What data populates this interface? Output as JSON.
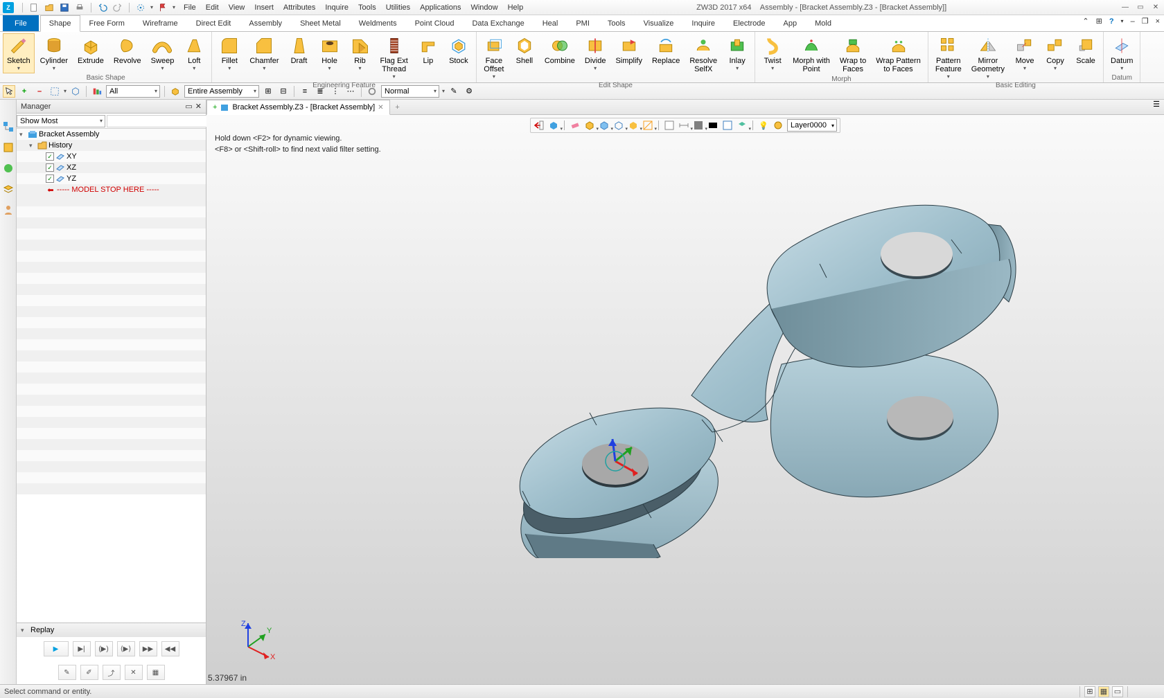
{
  "titlebar": {
    "app_title": "ZW3D 2017  x64",
    "doc_title": "Assembly - [Bracket Assembly.Z3 - [Bracket Assembly]]"
  },
  "menus": [
    "File",
    "Edit",
    "View",
    "Insert",
    "Attributes",
    "Inquire",
    "Tools",
    "Utilities",
    "Applications",
    "Window",
    "Help"
  ],
  "ribbon_tabs": [
    "File",
    "Shape",
    "Free Form",
    "Wireframe",
    "Direct Edit",
    "Assembly",
    "Sheet Metal",
    "Weldments",
    "Point Cloud",
    "Data Exchange",
    "Heal",
    "PMI",
    "Tools",
    "Visualize",
    "Inquire",
    "Electrode",
    "App",
    "Mold"
  ],
  "active_tab": "Shape",
  "ribbon_groups": {
    "basic_shape": {
      "label": "Basic Shape",
      "items": [
        "Sketch",
        "Cylinder",
        "Extrude",
        "Revolve",
        "Sweep",
        "Loft"
      ]
    },
    "eng_feature": {
      "label": "Engineering Feature",
      "items": [
        "Fillet",
        "Chamfer",
        "Draft",
        "Hole",
        "Rib",
        "Flag Ext\nThread",
        "Lip",
        "Stock"
      ]
    },
    "edit_shape": {
      "label": "Edit Shape",
      "items": [
        "Face\nOffset",
        "Shell",
        "Combine",
        "Divide",
        "Simplify",
        "Replace",
        "Resolve\nSelfX",
        "Inlay"
      ]
    },
    "morph": {
      "label": "Morph",
      "items": [
        "Twist",
        "Morph with\nPoint",
        "Wrap to\nFaces",
        "Wrap Pattern\nto Faces"
      ]
    },
    "basic_editing": {
      "label": "Basic Editing",
      "items": [
        "Pattern\nFeature",
        "Mirror\nGeometry",
        "Move",
        "Copy",
        "Scale"
      ]
    },
    "datum": {
      "label": "Datum",
      "items": [
        "Datum"
      ]
    }
  },
  "filter_bar": {
    "filter_label": "All",
    "scope_label": "Entire Assembly",
    "display_label": "Normal"
  },
  "manager": {
    "title": "Manager",
    "show_combo": "Show Most",
    "root": "Bracket Assembly",
    "history": "History",
    "planes": [
      "XY",
      "XZ",
      "YZ"
    ],
    "model_stop": "----- MODEL STOP HERE -----",
    "replay": "Replay"
  },
  "doc_tab": "Bracket Assembly.Z3 - [Bracket Assembly]",
  "viewport": {
    "hint1": "Hold down <F2> for dynamic viewing.",
    "hint2": "<F8> or <Shift-roll> to find next valid filter setting.",
    "dim_value": "5.37967 in",
    "layer": "Layer0000"
  },
  "status": {
    "prompt": "Select command or entity."
  },
  "axes": {
    "x": "X",
    "y": "Y",
    "z": "Z"
  }
}
